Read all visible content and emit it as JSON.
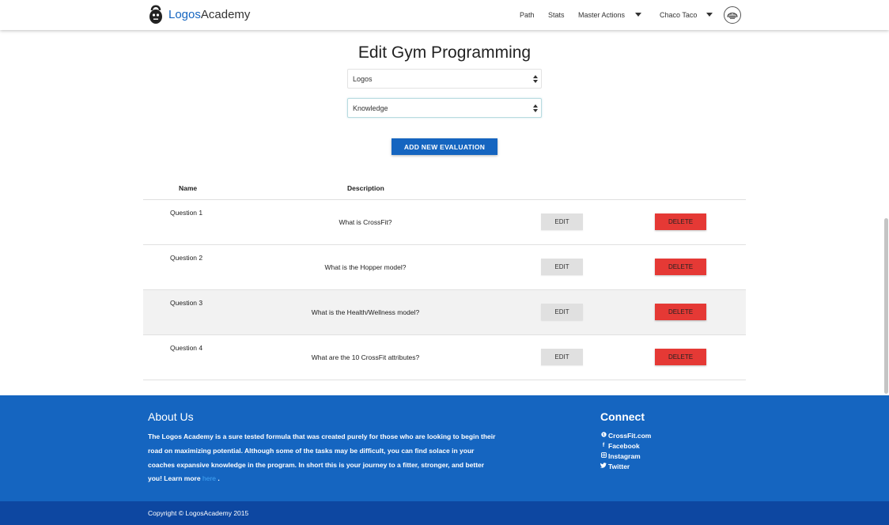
{
  "brand": {
    "name_highlight": "Logos",
    "name_rest": "Academy"
  },
  "nav": {
    "path": "Path",
    "stats": "Stats",
    "master_actions": "Master Actions",
    "user": "Chaco Taco"
  },
  "page": {
    "title": "Edit Gym Programming",
    "gym_select": "Logos",
    "category_select": "Knowledge",
    "add_button": "ADD NEW EVALUATION"
  },
  "table": {
    "headers": {
      "name": "Name",
      "description": "Description"
    },
    "rows": [
      {
        "name": "Question 1",
        "description": "What is CrossFit?",
        "edit": "EDIT",
        "delete": "DELETE"
      },
      {
        "name": "Question 2",
        "description": "What is the Hopper model?",
        "edit": "EDIT",
        "delete": "DELETE"
      },
      {
        "name": "Question 3",
        "description": "What is the Health/Wellness model?",
        "edit": "EDIT",
        "delete": "DELETE"
      },
      {
        "name": "Question 4",
        "description": "What are the 10 CrossFit attributes?",
        "edit": "EDIT",
        "delete": "DELETE"
      }
    ]
  },
  "footer": {
    "about_title": "About Us",
    "about_text": "The Logos Academy is a sure tested formula that was created purely for those who are looking to begin their road on maximizing potential. Although some of the tasks may be difficult, you can find solace in your coaches expansive knowledge in the program. In short this is your journey to a fitter, stronger, and better you! Learn more",
    "here_link": "here",
    "period": " .",
    "connect_title": "Connect",
    "links": [
      {
        "icon": "globe-icon",
        "label": "CrossFit.com"
      },
      {
        "icon": "facebook-icon",
        "label": "Facebook"
      },
      {
        "icon": "instagram-icon",
        "label": "Instagram"
      },
      {
        "icon": "twitter-icon",
        "label": "Twitter"
      }
    ],
    "copyright": "Copyright © LogosAcademy 2015"
  },
  "colors": {
    "primary": "#1565c0",
    "primary_dark": "#0d47a1",
    "danger": "#e53935",
    "link": "#42a5f5"
  }
}
